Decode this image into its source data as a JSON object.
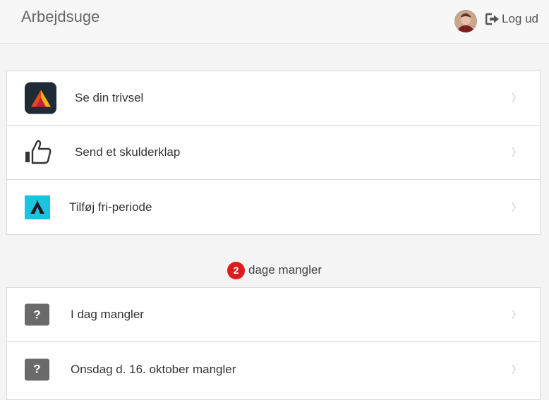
{
  "header": {
    "title": "Arbejdsuge",
    "avatar_icon": "user-avatar",
    "logout_icon": "sign-out-icon",
    "logout_label": "Log ud"
  },
  "actions": [
    {
      "icon": "app-logo-icon",
      "label": "Se din trivsel"
    },
    {
      "icon": "thumbs-up-icon",
      "label": "Send et skulderklap"
    },
    {
      "icon": "tent-icon",
      "label": "Tilføj fri-periode"
    }
  ],
  "missing": {
    "count": "2",
    "text": "dage mangler",
    "badge_color": "#dd1c1c",
    "items": [
      {
        "icon": "question-icon",
        "label": "I dag mangler"
      },
      {
        "icon": "question-icon",
        "label": "Onsdag d. 16. oktober mangler"
      }
    ]
  },
  "chevron": "〉",
  "colors": {
    "tent_bg": "#1cc3e0",
    "question_bg": "#6a6a6a",
    "app_icon_bg": "#1f2b36"
  }
}
